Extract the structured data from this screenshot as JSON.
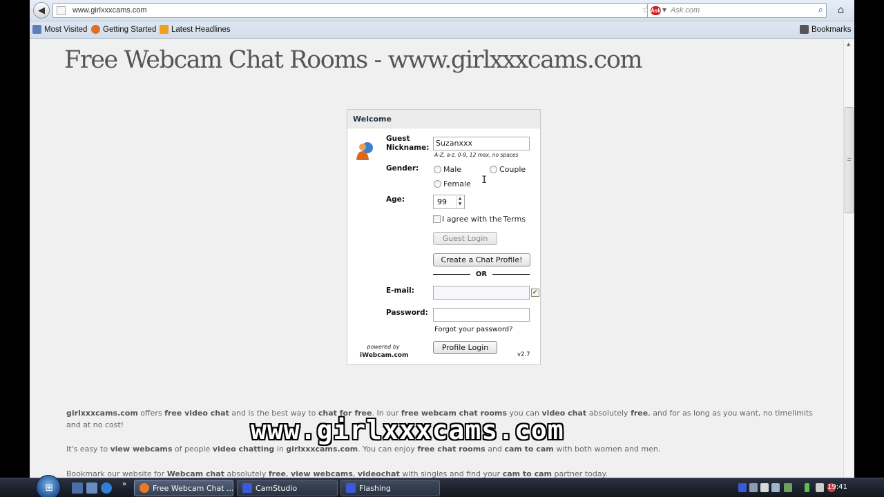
{
  "browser": {
    "url": "www.girlxxxcams.com",
    "search_placeholder": "Ask.com",
    "search_engine_logo": "Ask",
    "bookmarks": [
      "Most Visited",
      "Getting Started",
      "Latest Headlines"
    ],
    "bookmarks_menu": "Bookmarks"
  },
  "page": {
    "title": "Free Webcam Chat Rooms - www.girlxxxcams.com"
  },
  "login": {
    "header": "Welcome",
    "guest_nickname_label_1": "Guest",
    "guest_nickname_label_2": "Nickname:",
    "nickname_value": "Suzanxxx",
    "nickname_hint": "A-Z, a-z, 0-9, 12 max, no spaces",
    "gender_label": "Gender:",
    "gender_options": [
      "Male",
      "Couple",
      "Female"
    ],
    "age_label": "Age:",
    "age_value": "99",
    "agree_prefix": "I agree with the ",
    "agree_link": "Terms",
    "guest_login": "Guest Login",
    "create_profile": "Create a Chat Profile!",
    "or": "OR",
    "email_label": "E-mail:",
    "password_label": "Password:",
    "forgot": "Forgot your password?",
    "powered_by": "powered by",
    "powered_site": "iWebcam.com",
    "profile_login": "Profile Login",
    "version": "v2.7"
  },
  "body": {
    "p1_brand": "girlxxxcams.com",
    "p1_a": " offers ",
    "p1_b": "free video chat",
    "p1_c": " and is the best way to ",
    "p1_d": "chat for free",
    "p1_e": ". In our ",
    "p1_f": "free webcam chat rooms",
    "p1_g": " you can ",
    "p1_h": "video chat",
    "p1_i": " absolutely ",
    "p1_j": "free",
    "p1_k": ", and for as long as you want, no timelimits and at no cost!",
    "p2_a": "It's easy to ",
    "p2_b": "view webcams",
    "p2_c": " of people ",
    "p2_d": "video chatting",
    "p2_e": " in ",
    "p2_f": "girlxxxcams.com",
    "p2_g": ". You can enjoy ",
    "p2_h": "free chat rooms",
    "p2_i": " and ",
    "p2_j": "cam to cam",
    "p2_k": " with both women and men.",
    "p3_a": "Bookmark our website for ",
    "p3_b": "Webcam chat",
    "p3_c": " absolutely ",
    "p3_d": "free",
    "p3_e": ", ",
    "p3_f": "view webcams",
    "p3_g": ", ",
    "p3_h": "videochat",
    "p3_i": " with singles and find your ",
    "p3_j": "cam to cam",
    "p3_k": " partner today.",
    "watermark": "www.girlxxxcams.com"
  },
  "taskbar": {
    "tasks": [
      "Free Webcam Chat ...",
      "CamStudio",
      "Flashing"
    ],
    "clock": "19:41"
  },
  "colors": {
    "task_firefox": "#e8782a",
    "task_app": "#3b5bd6"
  }
}
